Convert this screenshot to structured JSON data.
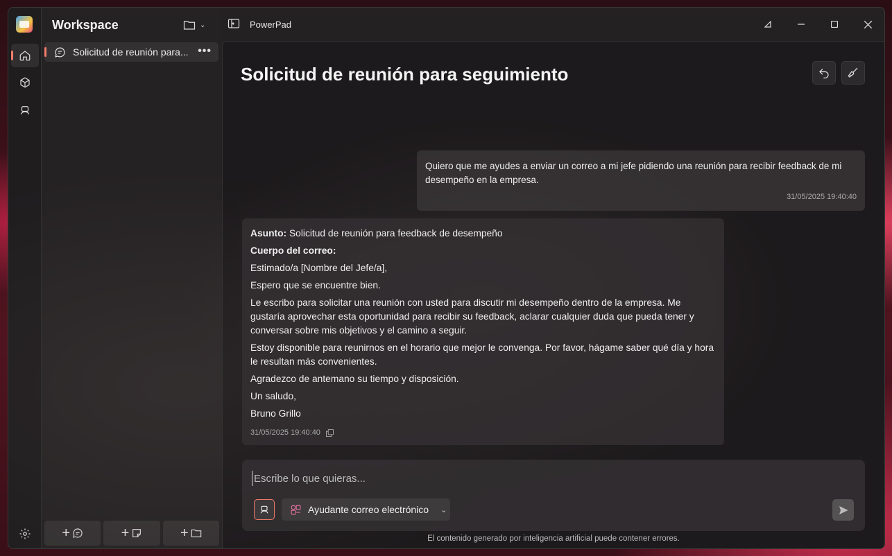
{
  "app": {
    "title": "PowerPad"
  },
  "sidebar": {
    "title": "Workspace",
    "chats": [
      {
        "label": "Solicitud de reunión para..."
      }
    ]
  },
  "chat": {
    "title": "Solicitud de reunión para seguimiento",
    "user_message": {
      "text": "Quiero que me ayudes a enviar un correo a mi jefe pidiendo una reunión para recibir feedback de mi desempeño en la empresa.",
      "timestamp": "31/05/2025 19:40:40"
    },
    "ai_message": {
      "subject_label": "Asunto:",
      "subject": " Solicitud de reunión para feedback de desempeño",
      "body_label": "Cuerpo del correo:",
      "paragraphs": [
        "Estimado/a [Nombre del Jefe/a],",
        "Espero que se encuentre bien.",
        "Le escribo para solicitar una reunión con usted para discutir mi desempeño dentro de la empresa. Me gustaría aprovechar esta oportunidad para recibir su feedback, aclarar cualquier duda que pueda tener y conversar sobre mis objetivos y el camino a seguir.",
        "Estoy disponible para reunirnos en el horario que mejor le convenga. Por favor, hágame saber qué día y hora le resultan más convenientes.",
        "Agradezco de antemano su tiempo y disposición.",
        "Un saludo,",
        "Bruno Grillo"
      ],
      "timestamp": "31/05/2025 19:40:40"
    }
  },
  "composer": {
    "placeholder": "Escribe lo que quieras...",
    "agent": "Ayudante correo electrónico",
    "disclaimer": "El contenido generado por inteligencia artificial puede contener errores."
  },
  "colors": {
    "accent": "#f47c6a"
  }
}
